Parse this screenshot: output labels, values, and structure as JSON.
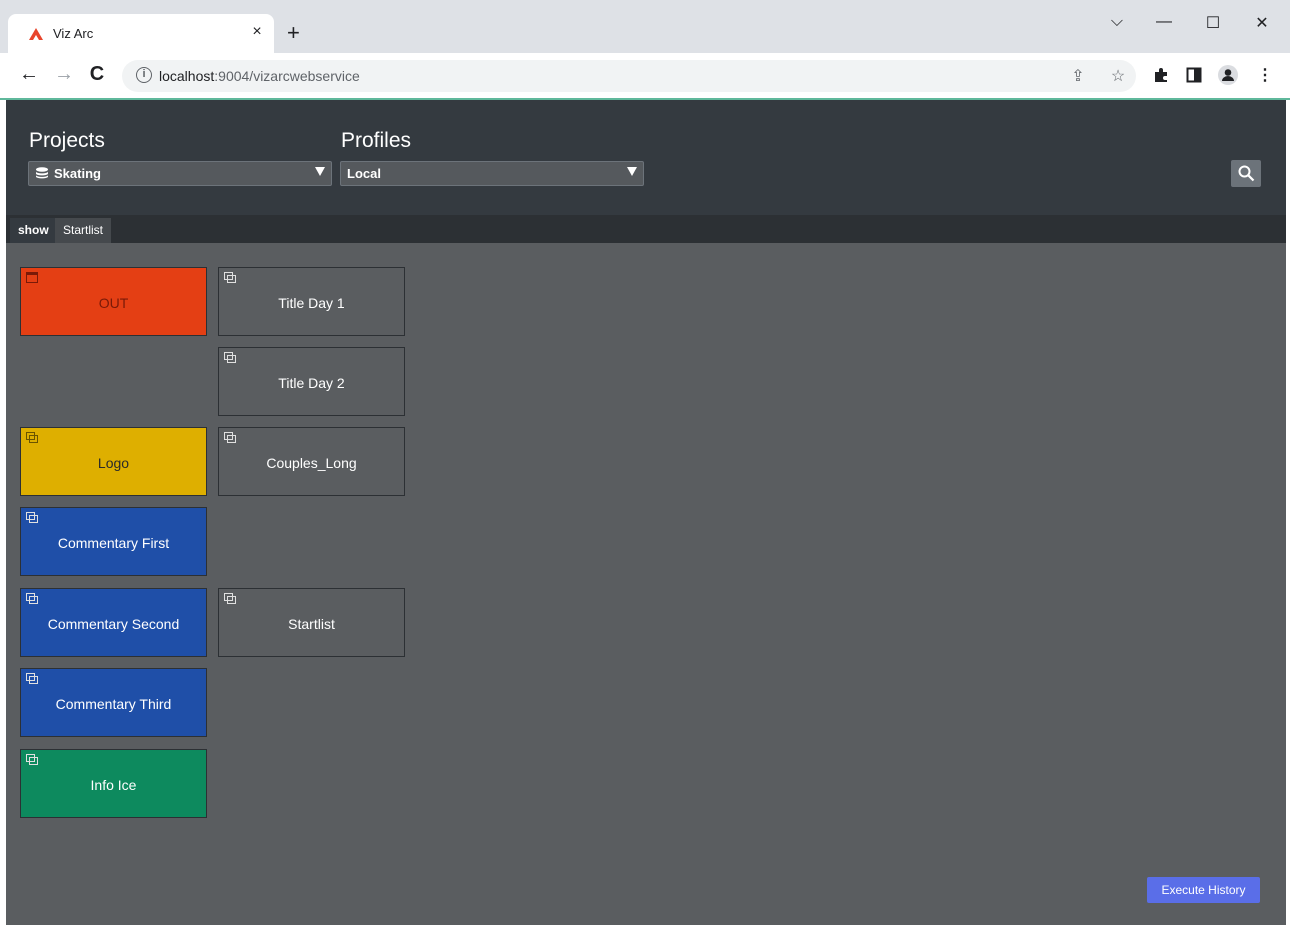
{
  "browser": {
    "tab_title": "Viz Arc",
    "tab_close_glyph": "×",
    "new_tab_glyph": "+",
    "url_host": "localhost",
    "url_rest": ":9004/vizarcwebservice",
    "window_controls": {
      "dropdown": "⌵",
      "minimize": "—",
      "maximize": "☐",
      "close": "✕"
    }
  },
  "header": {
    "projects_title": "Projects",
    "project_selected": "Skating",
    "profiles_title": "Profiles",
    "profile_selected": "Local"
  },
  "tabs": [
    {
      "label": "show",
      "active": true
    },
    {
      "label": "Startlist",
      "active": false
    }
  ],
  "tiles": [
    {
      "label": "OUT",
      "color": "#e43f14",
      "icon": "console-icon"
    },
    {
      "label": "Title Day 1",
      "color": "#5a5d60",
      "icon": "template-icon"
    },
    {
      "label": "Title Day 2",
      "color": "#5a5d60",
      "icon": "template-icon"
    },
    {
      "label": "Logo",
      "color": "#deaf00",
      "icon": "template-icon"
    },
    {
      "label": "Couples_Long",
      "color": "#5a5d60",
      "icon": "template-icon"
    },
    {
      "label": "Commentary First",
      "color": "#1f4fa8",
      "icon": "template-icon"
    },
    {
      "label": "Commentary Second",
      "color": "#1f4fa8",
      "icon": "template-icon"
    },
    {
      "label": "Startlist",
      "color": "#5a5d60",
      "icon": "template-icon"
    },
    {
      "label": "Commentary Third",
      "color": "#1f4fa8",
      "icon": "template-icon"
    },
    {
      "label": "Info Ice",
      "color": "#0d8a5e",
      "icon": "template-icon"
    }
  ],
  "actions": {
    "execute_history": "Execute History"
  },
  "colors": {
    "accent": "#5a6ee8",
    "header_bg": "#343a40",
    "canvas_bg": "#5a5d60"
  }
}
